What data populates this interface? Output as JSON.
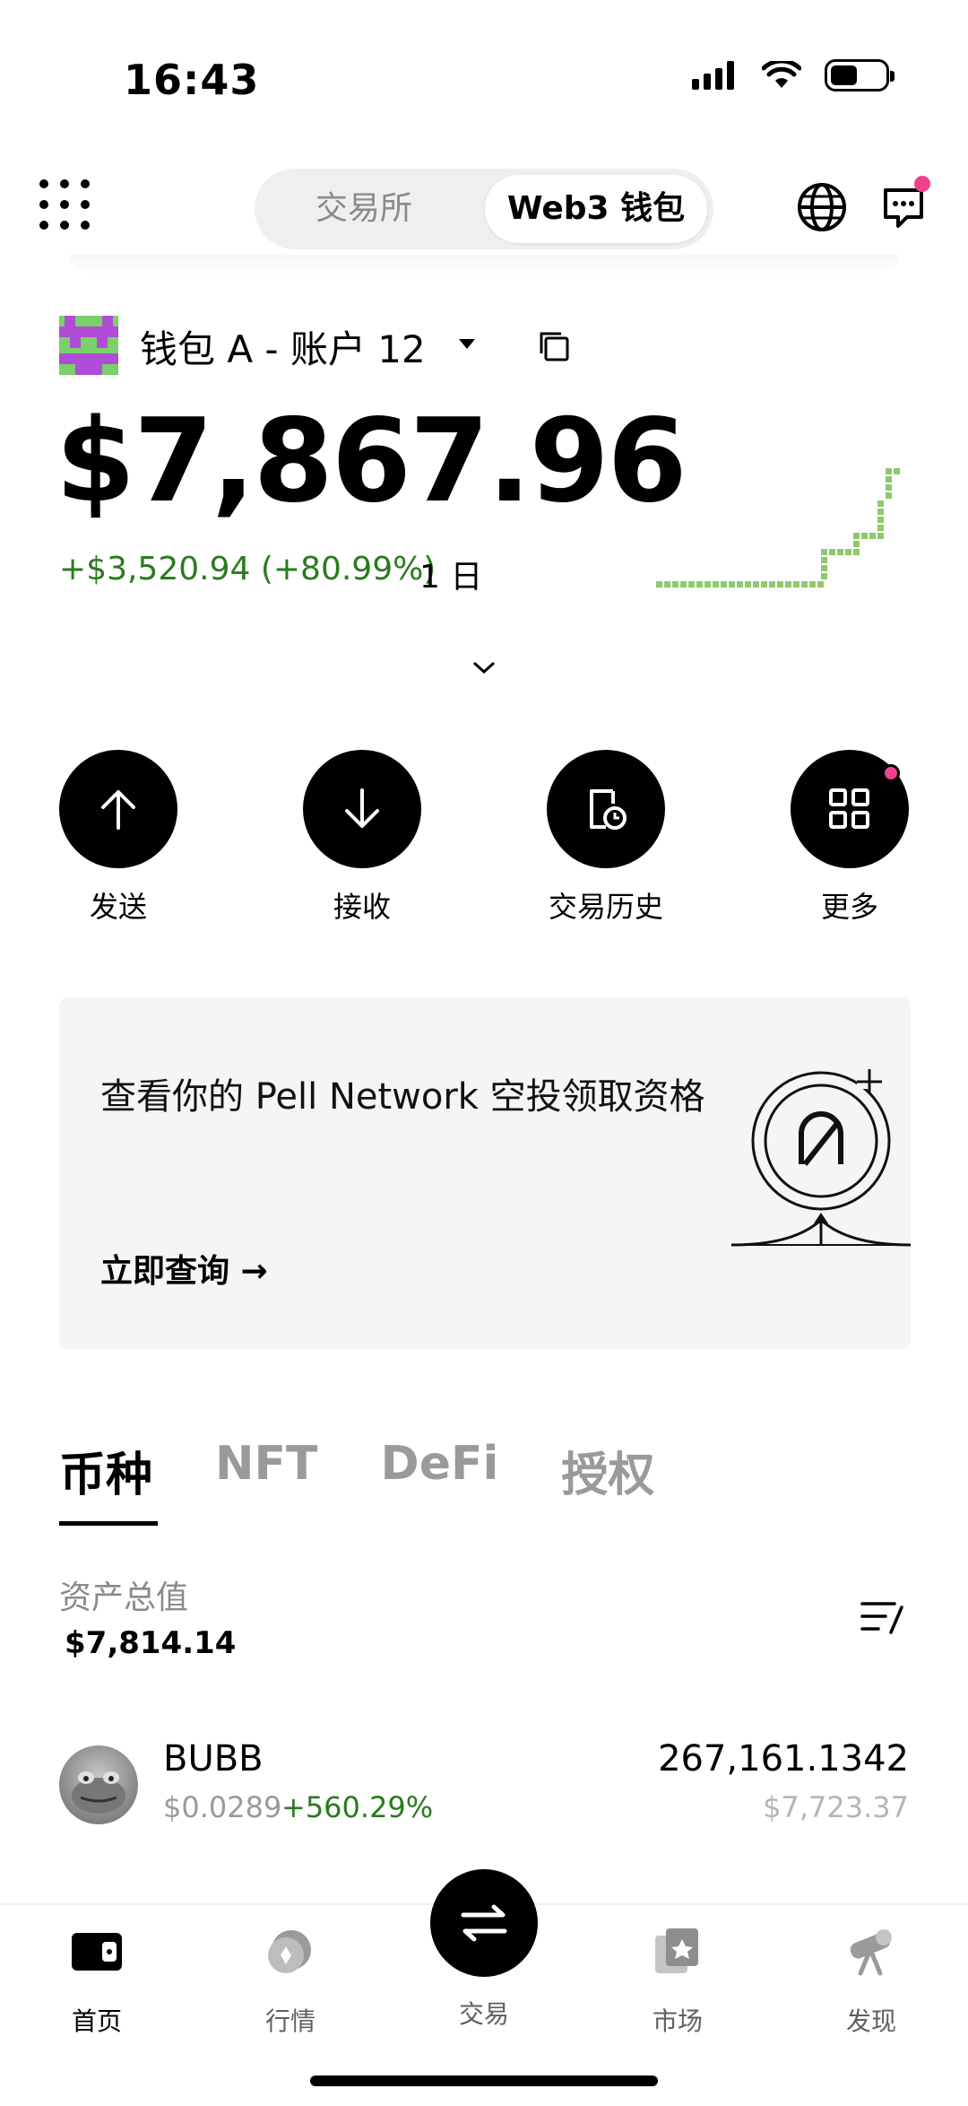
{
  "status_bar": {
    "time": "16:43"
  },
  "header": {
    "tabs": [
      "交易所",
      "Web3 钱包"
    ],
    "active_tab": "Web3 钱包"
  },
  "account": {
    "name": "钱包 A - 账户 12",
    "balance": "$7,867.96",
    "pnl": "+$3,520.94 (+80.99%)",
    "period": "1 日"
  },
  "actions": [
    {
      "label": "发送",
      "icon": "arrow-up-icon"
    },
    {
      "label": "接收",
      "icon": "arrow-down-icon"
    },
    {
      "label": "交易历史",
      "icon": "history-icon"
    },
    {
      "label": "更多",
      "icon": "apps-grid-icon"
    }
  ],
  "banner": {
    "title": "查看你的 Pell Network 空投领取资格",
    "link": "立即查询 →"
  },
  "asset_tabs": [
    "币种",
    "NFT",
    "DeFi",
    "授权"
  ],
  "assets": {
    "total_label": "资产总值",
    "total_value": "$7,814.14",
    "tokens": [
      {
        "symbol": "BUBB",
        "price": "$0.0289",
        "change": "+560.29%",
        "amount": "267,161.1342",
        "value": "$7,723.37"
      }
    ]
  },
  "bottom_nav": {
    "items": [
      "首页",
      "行情",
      "交易",
      "市场",
      "发现"
    ],
    "active": "首页"
  },
  "colors": {
    "positive": "#2a7a1e",
    "notification": "#f0418e",
    "sparkline": "#8fc96b"
  }
}
